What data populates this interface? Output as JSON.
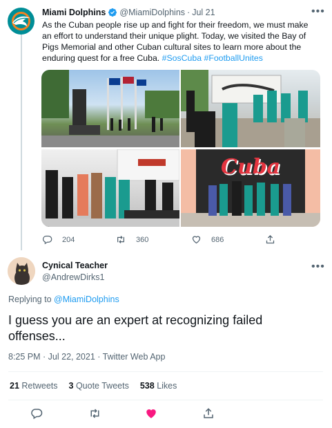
{
  "colors": {
    "accent": "#1d9bf0",
    "like": "#f91880",
    "dolphins_teal": "#008e97"
  },
  "original_tweet": {
    "author_name": "Miami Dolphins",
    "handle": "@MiamiDolphins",
    "sep": "·",
    "date": "Jul 21",
    "text_lines": [
      "As the Cuban people rise up and fight for their freedom, we must make",
      "an effort to understand their unique plight. Today, we visited the Bay of",
      "Pigs Memorial and other Cuban cultural sites to learn more about the"
    ],
    "text_last": "enduring quest for a free Cuba.",
    "hashtags": "#SosCuba #FootballUnites",
    "photo_mural_text": "Cuba",
    "counts": {
      "replies": "204",
      "retweets": "360",
      "likes": "686"
    }
  },
  "reply": {
    "author_name": "Cynical Teacher",
    "handle": "@AndrewDirks1",
    "replying_prefix": "Replying to",
    "replying_to": "@MiamiDolphins",
    "text_line1": "I guess you are an expert at recognizing failed",
    "text_line2": "offenses...",
    "timestamp": "8:25 PM · Jul 22, 2021 · Twitter Web App",
    "stats": {
      "retweets_count": "21",
      "retweets_label": "Retweets",
      "quotes_count": "3",
      "quotes_label": "Quote Tweets",
      "likes_count": "538",
      "likes_label": "Likes"
    }
  },
  "icons": {
    "more": "more-dots-icon",
    "verified": "verified-badge-icon",
    "reply": "reply-bubble-icon",
    "retweet": "retweet-arrows-icon",
    "like": "heart-icon",
    "share": "share-upload-icon"
  }
}
